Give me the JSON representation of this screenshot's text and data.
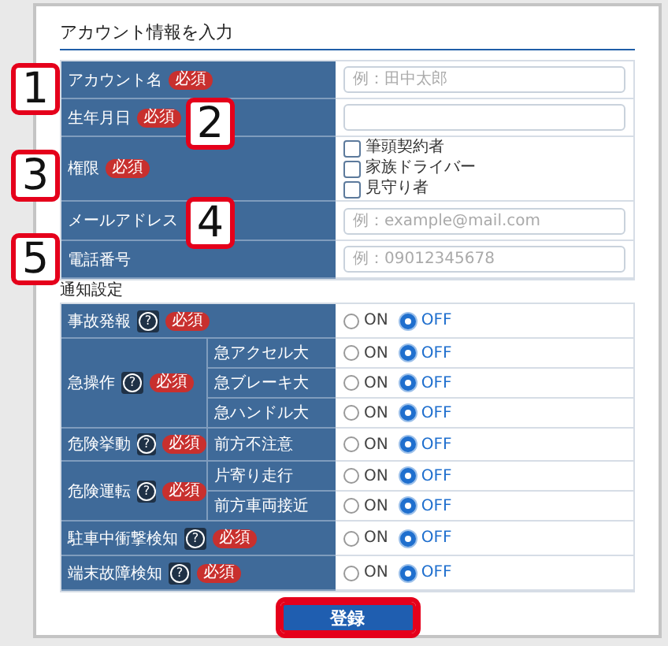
{
  "form": {
    "title": "アカウント情報を入力",
    "fields": [
      {
        "kind": "text",
        "label": "アカウント名",
        "badge": "必須",
        "placeholder": "例：田中太郎"
      },
      {
        "kind": "text",
        "label": "生年月日",
        "badge": "必須"
      },
      {
        "kind": "checkboxes",
        "label": "権限",
        "badge": "必須",
        "options": [
          {
            "label": "筆頭契約者",
            "checked": false
          },
          {
            "label": "家族ドライバー",
            "checked": false
          },
          {
            "label": "見守り者",
            "checked": false
          }
        ]
      },
      {
        "kind": "text",
        "label": "メールアドレス",
        "placeholder": "例：example@mail.com"
      },
      {
        "kind": "text",
        "label": "電話番号",
        "placeholder": "例：09012345678"
      }
    ],
    "notify_title": "通知設定",
    "notifications": [
      {
        "label": "事故発報",
        "help": "?",
        "badge": "必須",
        "items": [
          {
            "options": [
              {
                "label": "ON",
                "selected": false
              },
              {
                "label": "OFF",
                "selected": true
              }
            ]
          }
        ]
      },
      {
        "label": "急操作",
        "help": "?",
        "badge": "必須",
        "items": [
          {
            "sublabel": "急アクセル大",
            "options": [
              {
                "label": "ON",
                "selected": false
              },
              {
                "label": "OFF",
                "selected": true
              }
            ]
          },
          {
            "sublabel": "急ブレーキ大",
            "options": [
              {
                "label": "ON",
                "selected": false
              },
              {
                "label": "OFF",
                "selected": true
              }
            ]
          },
          {
            "sublabel": "急ハンドル大",
            "options": [
              {
                "label": "ON",
                "selected": false
              },
              {
                "label": "OFF",
                "selected": true
              }
            ]
          }
        ]
      },
      {
        "label": "危険挙動",
        "help": "?",
        "badge": "必須",
        "items": [
          {
            "sublabel": "前方不注意",
            "options": [
              {
                "label": "ON",
                "selected": false
              },
              {
                "label": "OFF",
                "selected": true
              }
            ]
          }
        ]
      },
      {
        "label": "危険運転",
        "help": "?",
        "badge": "必須",
        "items": [
          {
            "sublabel": "片寄り走行",
            "options": [
              {
                "label": "ON",
                "selected": false
              },
              {
                "label": "OFF",
                "selected": true
              }
            ]
          },
          {
            "sublabel": "前方車両接近",
            "options": [
              {
                "label": "ON",
                "selected": false
              },
              {
                "label": "OFF",
                "selected": true
              }
            ]
          }
        ]
      },
      {
        "label": "駐車中衝撃検知",
        "help": "?",
        "badge": "必須",
        "items": [
          {
            "options": [
              {
                "label": "ON",
                "selected": false
              },
              {
                "label": "OFF",
                "selected": true
              }
            ]
          }
        ]
      },
      {
        "label": "端末故障検知",
        "help": "?",
        "badge": "必須",
        "items": [
          {
            "options": [
              {
                "label": "ON",
                "selected": false
              },
              {
                "label": "OFF",
                "selected": true
              }
            ]
          }
        ]
      }
    ],
    "submit": {
      "label": "登録",
      "highlighted": true
    }
  },
  "callouts": [
    {
      "number": "1"
    },
    {
      "number": "2"
    },
    {
      "number": "3"
    },
    {
      "number": "4"
    },
    {
      "number": "5"
    }
  ]
}
